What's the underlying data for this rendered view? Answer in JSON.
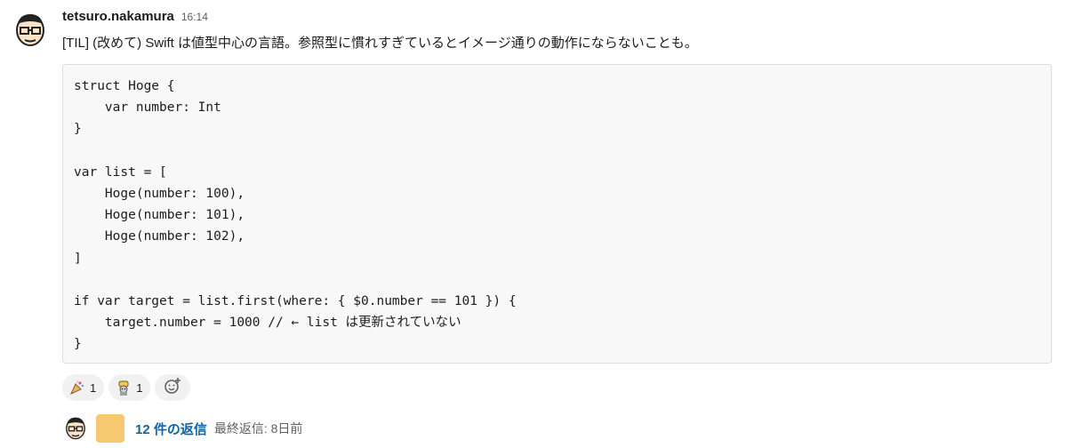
{
  "message": {
    "username": "tetsuro.nakamura",
    "timestamp": "16:14",
    "text": "[TIL] (改めて) Swift は値型中心の言語。参照型に慣れすぎているとイメージ通りの動作にならないことも。",
    "code": "struct Hoge {\n    var number: Int\n}\n\nvar list = [\n    Hoge(number: 100),\n    Hoge(number: 101),\n    Hoge(number: 102),\n]\n\nif var target = list.first(where: { $0.number == 101 }) {\n    target.number = 1000 // ← list は更新されていない\n}"
  },
  "reactions": [
    {
      "icon": "party-reaction-icon",
      "count": "1"
    },
    {
      "icon": "character-reaction-icon",
      "count": "1"
    }
  ],
  "add_reaction_icon": "add-reaction-icon",
  "thread": {
    "count_label": "12 件の返信",
    "last_reply": "最終返信: 8日前"
  },
  "colors": {
    "link": "#1264a3",
    "code_bg": "#f8f8f8",
    "reaction_bg": "#f1f1f1",
    "yellow_avatar": "#f6c86f"
  }
}
